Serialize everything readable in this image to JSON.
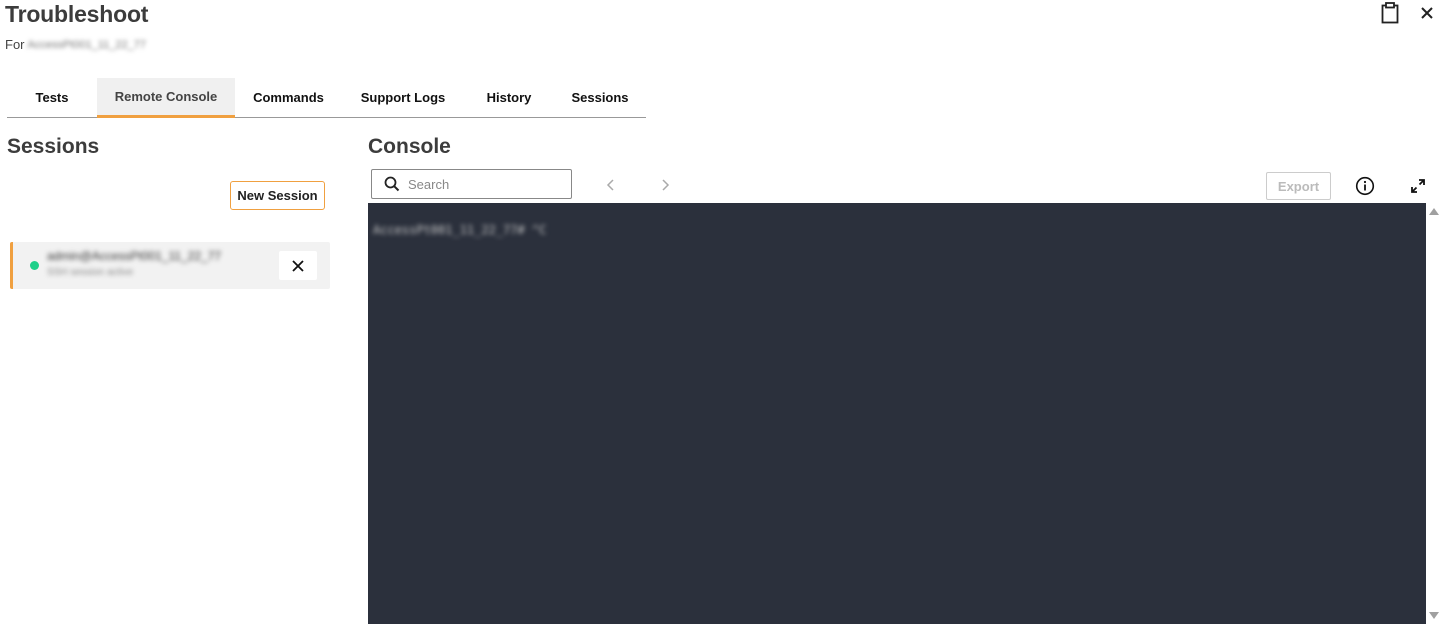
{
  "header": {
    "title": "Troubleshoot",
    "for_label": "For",
    "for_value": "AccessPt001_11_22_77"
  },
  "tabs": [
    {
      "label": "Tests",
      "active": false
    },
    {
      "label": "Remote Console",
      "active": true
    },
    {
      "label": "Commands",
      "active": false
    },
    {
      "label": "Support Logs",
      "active": false
    },
    {
      "label": "History",
      "active": false
    },
    {
      "label": "Sessions",
      "active": false
    }
  ],
  "sessions_panel": {
    "title": "Sessions",
    "new_session_label": "New Session",
    "items": [
      {
        "name": "admin@AccessPt001_11_22_77",
        "subtitle": "SSH session active",
        "status": "connected",
        "status_color": "#1fd08a"
      }
    ]
  },
  "console_panel": {
    "title": "Console",
    "search_placeholder": "Search",
    "search_value": "",
    "export_label": "Export",
    "output_line": "AccessPt001_11_22_77# ^C"
  },
  "icons": {
    "clipboard": "clipboard-icon",
    "close": "close-icon",
    "search": "search-icon",
    "prev": "chevron-left-icon",
    "next": "chevron-right-icon",
    "info": "info-icon",
    "expand": "expand-icon",
    "remove_session": "close-icon"
  },
  "colors": {
    "accent": "#f0a040",
    "console_bg": "#2b303c",
    "status_green": "#1fd08a"
  }
}
